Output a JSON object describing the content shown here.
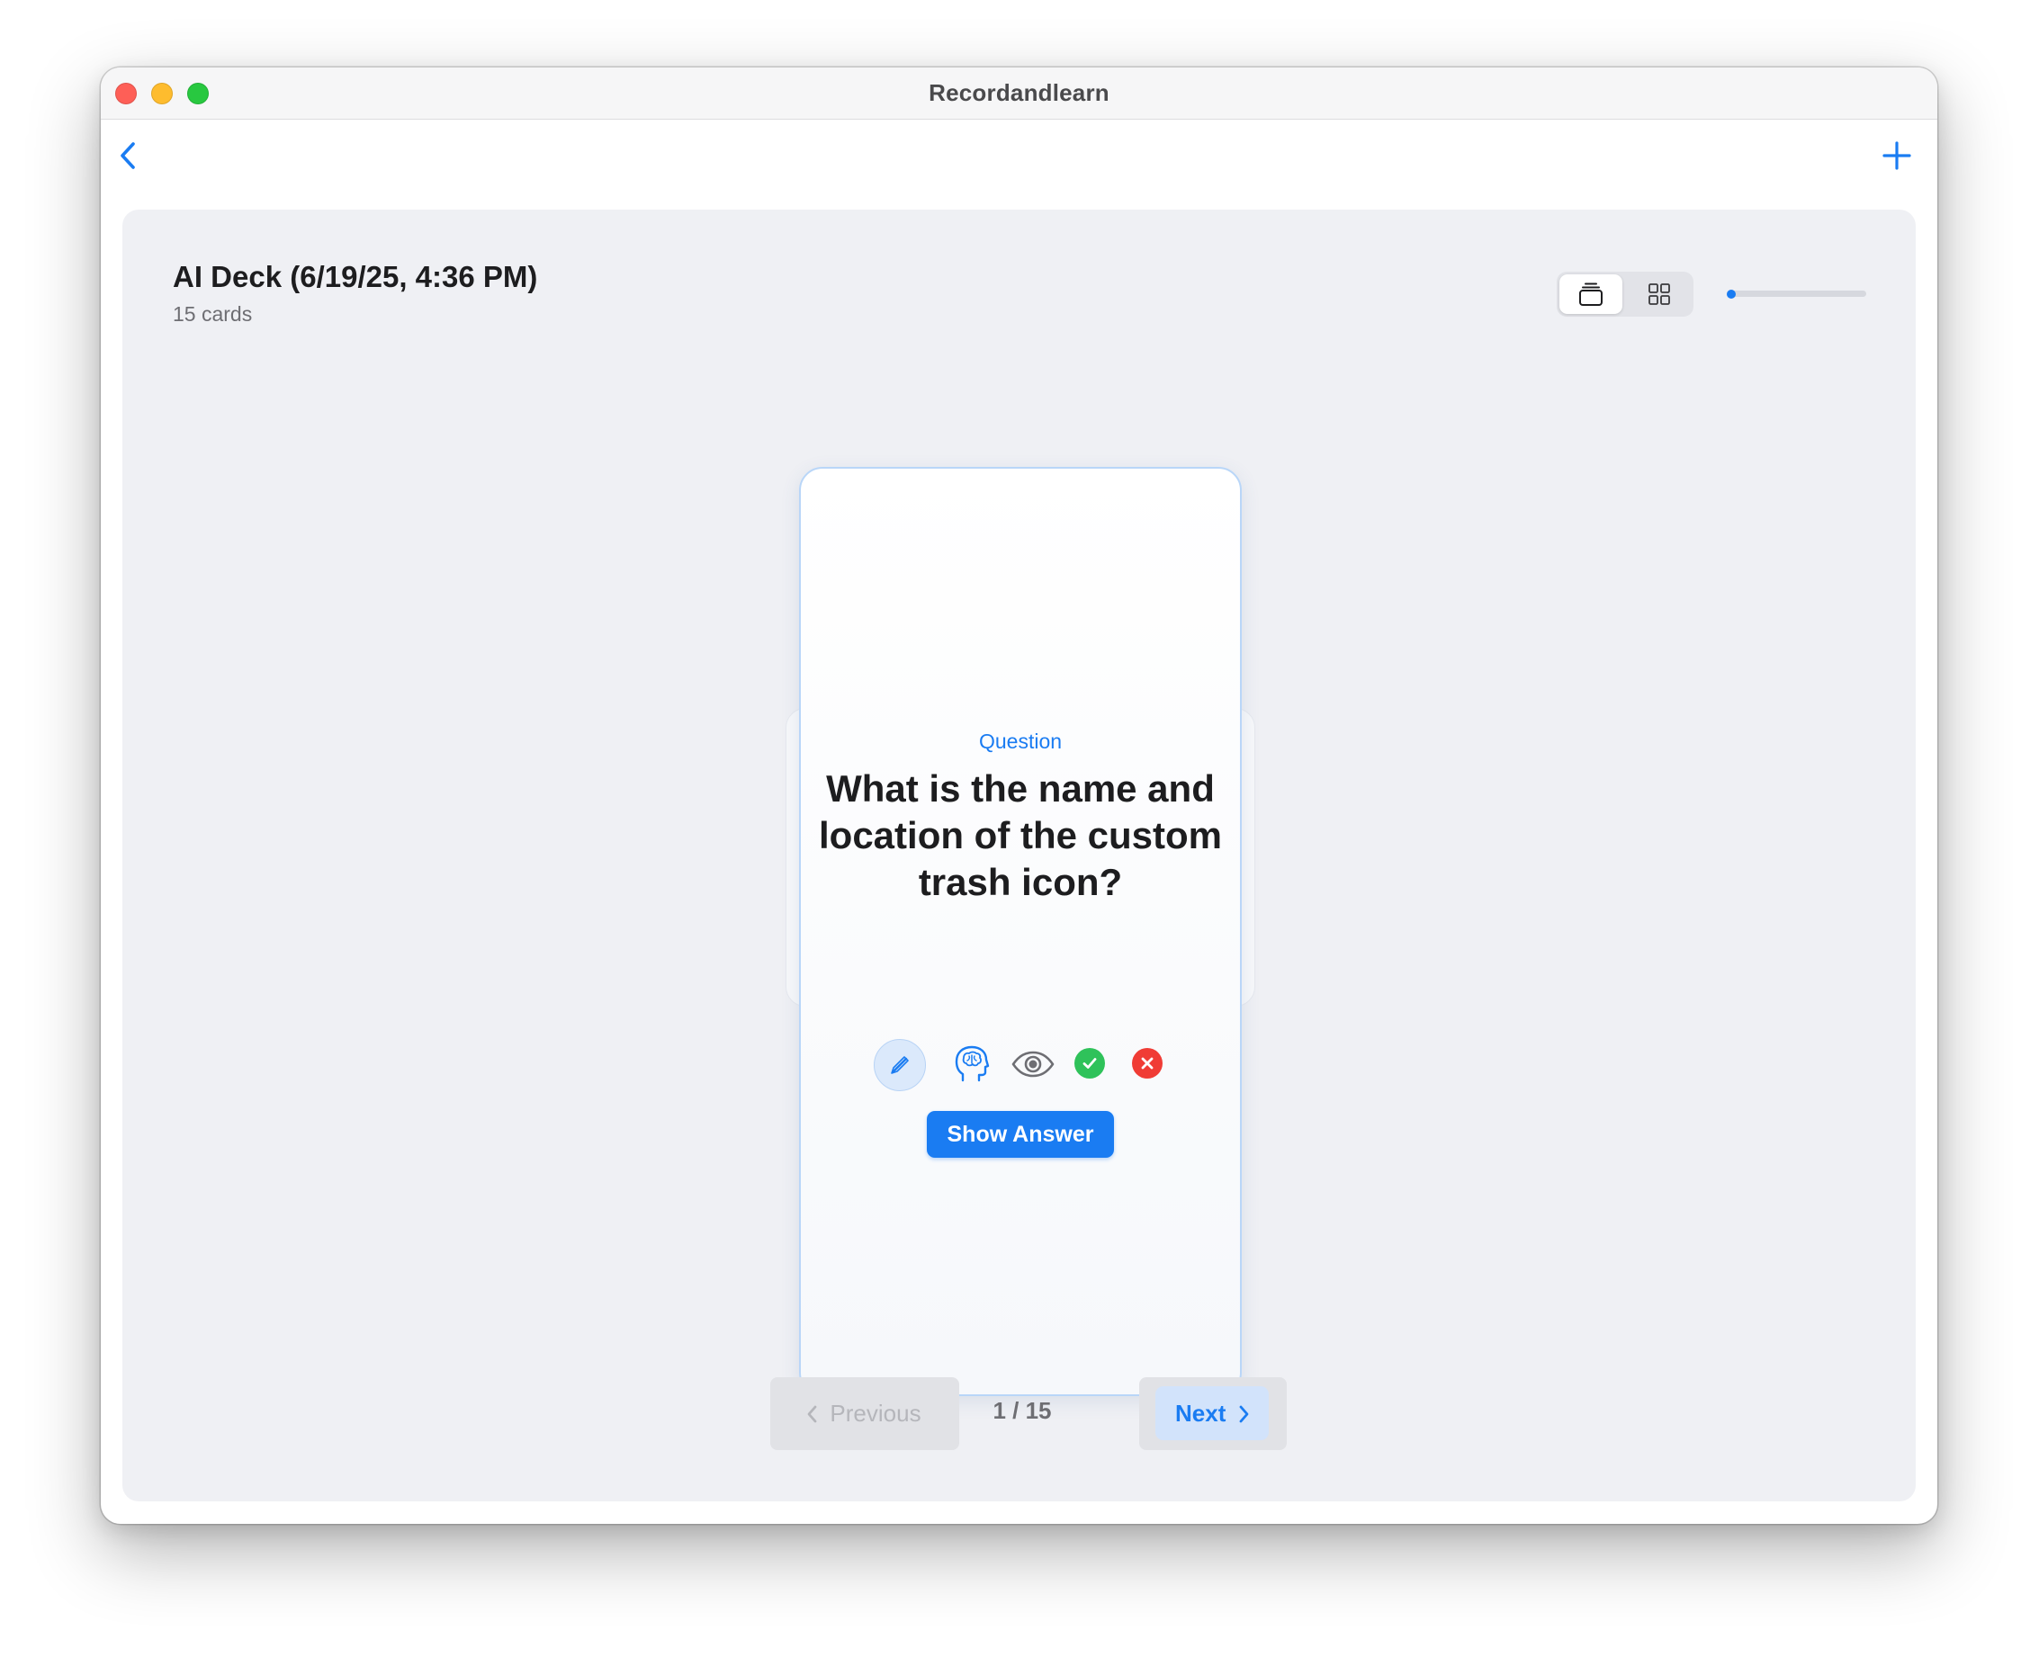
{
  "window": {
    "title": "Recordandlearn"
  },
  "toolbar": {
    "back_icon": "chevron-left-icon",
    "add_icon": "plus-icon"
  },
  "deck": {
    "title": "AI Deck (6/19/25, 4:36 PM)",
    "card_count": "15 cards"
  },
  "view_toggle": {
    "selected": "single-card",
    "options": [
      "single-card",
      "grid"
    ]
  },
  "progress": {
    "fraction": 0.0667
  },
  "card": {
    "label": "Question",
    "question": "What is the name and location of the custom trash icon?",
    "actions": [
      "pencil-icon",
      "brain-icon",
      "eye-icon",
      "checkmark-icon",
      "xmark-icon"
    ],
    "show_answer_label": "Show Answer"
  },
  "pagination": {
    "previous_label": "Previous",
    "next_label": "Next",
    "counter": "1 / 15"
  },
  "colors": {
    "accent": "#1a7cf2",
    "check": "#2fc25a",
    "cross": "#f03c35",
    "panel": "#eff0f4"
  }
}
